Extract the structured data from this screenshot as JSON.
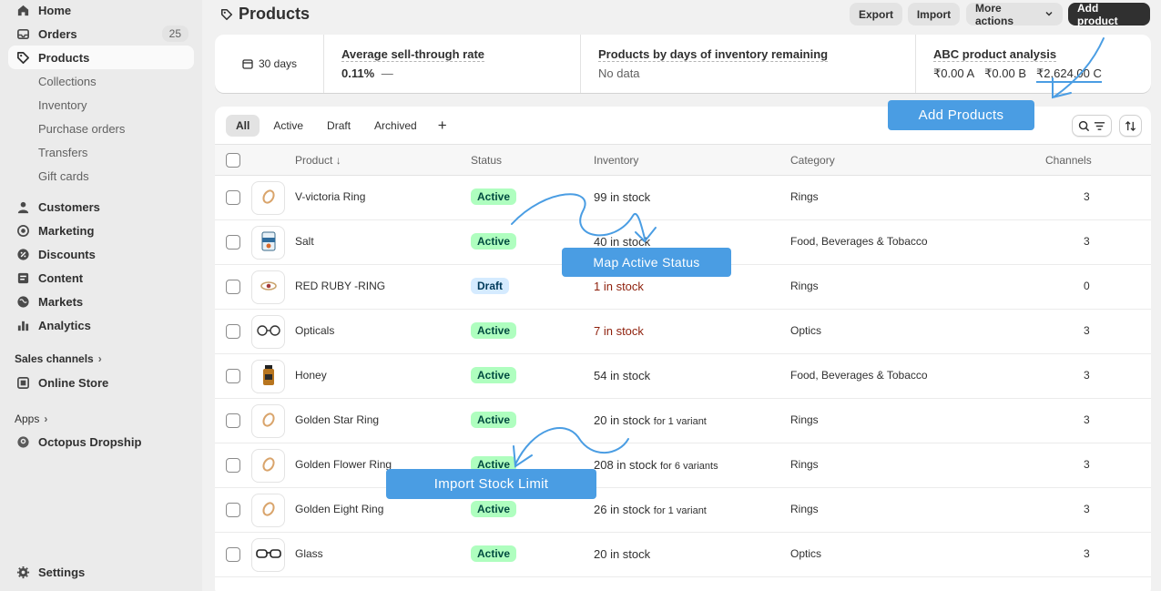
{
  "sidebar": {
    "home": "Home",
    "orders": "Orders",
    "orders_count": "25",
    "products": "Products",
    "sub_items": [
      "Collections",
      "Inventory",
      "Purchase orders",
      "Transfers",
      "Gift cards"
    ],
    "customers": "Customers",
    "marketing": "Marketing",
    "discounts": "Discounts",
    "content": "Content",
    "markets": "Markets",
    "analytics": "Analytics",
    "sales_channels": "Sales channels",
    "online_store": "Online Store",
    "apps": "Apps",
    "octopus": "Octopus Dropship",
    "settings": "Settings"
  },
  "header": {
    "title": "Products",
    "export": "Export",
    "import": "Import",
    "more_actions": "More actions",
    "add_product": "Add product"
  },
  "stats": {
    "period": "30 days",
    "sell_through_title": "Average sell-through rate",
    "sell_through_value": "0.11%",
    "sell_through_dash": "—",
    "days_inventory_title": "Products by days of inventory remaining",
    "days_inventory_value": "No data",
    "abc_title": "ABC product analysis",
    "abc_a": "₹0.00 A",
    "abc_b": "₹0.00 B",
    "abc_c": "₹2,624.00 C"
  },
  "tabs": [
    "All",
    "Active",
    "Draft",
    "Archived"
  ],
  "table": {
    "headers": {
      "product": "Product ↓",
      "status": "Status",
      "inventory": "Inventory",
      "category": "Category",
      "channels": "Channels"
    },
    "rows": [
      {
        "name": "V-victoria Ring",
        "status": "Active",
        "inventory": "99 in stock",
        "inventory_sub": "",
        "category": "Rings",
        "channels": "3"
      },
      {
        "name": "Salt",
        "status": "Active",
        "inventory": "40 in stock",
        "inventory_sub": "",
        "category": "Food, Beverages & Tobacco",
        "channels": "3"
      },
      {
        "name": "RED RUBY -RING",
        "status": "Draft",
        "inventory": "1 in stock",
        "inventory_sub": "",
        "category": "Rings",
        "channels": "0"
      },
      {
        "name": "Opticals",
        "status": "Active",
        "inventory": "7 in stock",
        "inventory_sub": "",
        "category": "Optics",
        "channels": "3"
      },
      {
        "name": "Honey",
        "status": "Active",
        "inventory": "54 in stock",
        "inventory_sub": "",
        "category": "Food, Beverages & Tobacco",
        "channels": "3"
      },
      {
        "name": "Golden Star Ring",
        "status": "Active",
        "inventory": "20 in stock",
        "inventory_sub": "for 1 variant",
        "category": "Rings",
        "channels": "3"
      },
      {
        "name": "Golden Flower Ring",
        "status": "Active",
        "inventory": "208 in stock",
        "inventory_sub": "for 6 variants",
        "category": "Rings",
        "channels": "3"
      },
      {
        "name": "Golden Eight Ring",
        "status": "Active",
        "inventory": "26 in stock",
        "inventory_sub": "for 1 variant",
        "category": "Rings",
        "channels": "3"
      },
      {
        "name": "Glass",
        "status": "Active",
        "inventory": "20 in stock",
        "inventory_sub": "",
        "category": "Optics",
        "channels": "3"
      }
    ]
  },
  "annotations": {
    "add_products": "Add Products",
    "map_active_status": "Map Active  Status",
    "import_stock_limit": "Import Stock Limit"
  },
  "colors": {
    "callout": "#4a9de3",
    "active_badge": "#affebf",
    "draft_badge": "#d5ebff",
    "low_stock": "#8e1f0b"
  }
}
